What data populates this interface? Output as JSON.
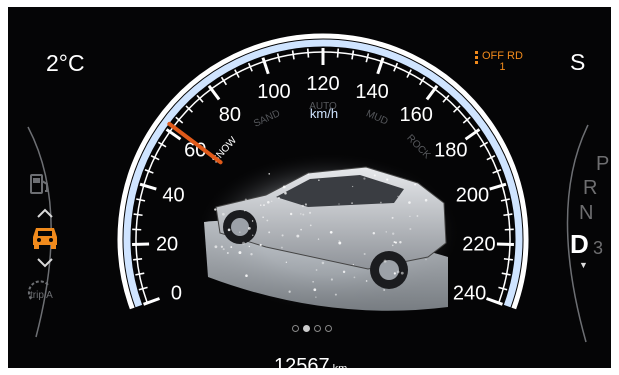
{
  "outside_temperature": "2°C",
  "drive_mode": "S",
  "terrain": {
    "label": "OFF RD",
    "level": "1",
    "selected_mode": "SNOW",
    "modes": [
      "SNOW",
      "SAND",
      "AUTO",
      "MUD",
      "ROCK"
    ]
  },
  "speedometer": {
    "unit": "km/h",
    "min": 0,
    "max": 240,
    "major_step": 20,
    "current_speed": 62,
    "tick_labels": [
      "0",
      "20",
      "40",
      "60",
      "80",
      "100",
      "120",
      "140",
      "160",
      "180",
      "200",
      "220",
      "240"
    ]
  },
  "odometer": {
    "value": "12567",
    "unit": "km"
  },
  "gear_selector": {
    "gears": [
      "P",
      "R",
      "N",
      "D"
    ],
    "selected": "D",
    "selected_gear_number": "3"
  },
  "left_icons": {
    "fuel": "fuel-pump-icon",
    "up": "arrow-up-icon",
    "vehicle": "vehicle-icon",
    "down": "arrow-down-icon",
    "trip": "trip A"
  },
  "page_indicator": {
    "count": 4,
    "active_index": 1
  },
  "colors": {
    "needle": "#e05a1a",
    "accent_orange": "#f08a1c",
    "gauge_blue": "#cfe4ff",
    "background": "#050506"
  }
}
